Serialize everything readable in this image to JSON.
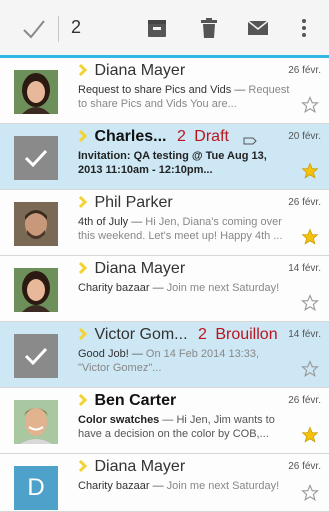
{
  "toolbar": {
    "selected_count": "2",
    "icons": [
      "check-icon",
      "archive-icon",
      "delete-icon",
      "mark-unread-icon",
      "overflow-icon"
    ],
    "accent": "#33b5e5"
  },
  "colors": {
    "selected_row": "#cde7f4",
    "draft": "#b9151f",
    "star": "#f4c20d",
    "chevron": "#f4d32f"
  },
  "messages": [
    {
      "sender": "Diana Mayer",
      "date": "26 févr.",
      "subject": "Request to share Pics and Vids",
      "preview": "Request to share Pics and Vids You are...",
      "selected": false,
      "starred": false,
      "avatar": "photo"
    },
    {
      "sender": "Charles...",
      "count": "2",
      "draft": "Draft",
      "date": "20 févr.",
      "subject": "Invitation: QA testing @ Tue Aug 13, 2013 11:10am - 12:10pm...",
      "preview": "",
      "selected": true,
      "starred": true,
      "avatar": "checked"
    },
    {
      "sender": "Phil Parker",
      "date": "26 févr.",
      "subject": "4th of July",
      "preview": "Hi Jen, Diana's coming over this weekend. Let's meet up! Happy 4th ...",
      "selected": false,
      "starred": true,
      "avatar": "photo"
    },
    {
      "sender": "Diana Mayer",
      "date": "14 févr.",
      "subject": "Charity bazaar",
      "preview": "Join me next Saturday!",
      "selected": false,
      "starred": false,
      "avatar": "photo"
    },
    {
      "sender": "Victor Gom...",
      "count": "2",
      "draft": "Brouillon",
      "date": "14 févr.",
      "subject": "Good Job!",
      "preview": "On 14 Feb 2014 13:33, \"Victor Gomez\"...",
      "selected": true,
      "starred": false,
      "avatar": "checked"
    },
    {
      "sender": "Ben Carter",
      "date": "26 févr.",
      "subject": "Color swatches",
      "preview": "Hi Jen, Jim wants to have a decision on the color by COB,...",
      "selected": false,
      "starred": true,
      "avatar": "photo"
    },
    {
      "sender": "Diana Mayer",
      "date": "26 févr.",
      "subject": "Charity bazaar",
      "preview": "Join me next Saturday!",
      "selected": false,
      "starred": false,
      "avatar": "letter",
      "letter": "D"
    }
  ]
}
